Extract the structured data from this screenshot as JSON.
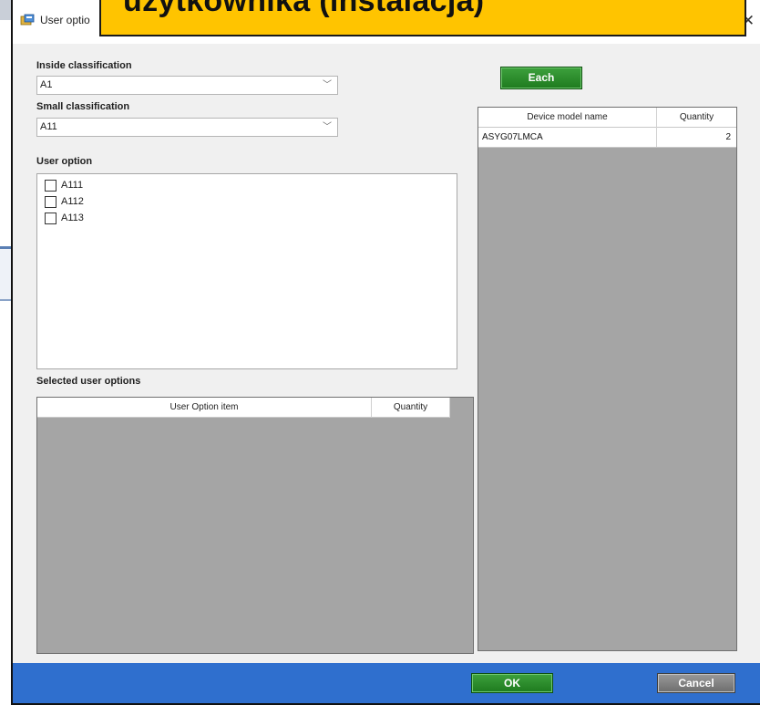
{
  "window": {
    "title": "User optio",
    "close_glyph": "✕",
    "banner_text": "użytkownika (instalacja)"
  },
  "inside_classification": {
    "label": "Inside classification",
    "value": "A1"
  },
  "small_classification": {
    "label": "Small classification",
    "value": "A11"
  },
  "user_option": {
    "label": "User option",
    "items": [
      {
        "label": "A111",
        "checked": false
      },
      {
        "label": "A112",
        "checked": false
      },
      {
        "label": "A113",
        "checked": false
      }
    ]
  },
  "selected_user_options": {
    "label": "Selected user options",
    "columns": [
      "User Option item",
      "Quantity"
    ],
    "rows": []
  },
  "device_grid": {
    "each_button": "Each",
    "columns": [
      "Device model name",
      "Quantity"
    ],
    "rows": [
      {
        "model": "ASYG07LMCA",
        "quantity": "2"
      }
    ]
  },
  "footer": {
    "ok_label": "OK",
    "cancel_label": "Cancel"
  },
  "colors": {
    "banner": "#ffc400",
    "footer": "#2f6fce",
    "primary_button": "#2a8a2a",
    "cancel_button": "#808080"
  },
  "icons": {
    "title": "app-window-icon",
    "close": "close-icon",
    "dropdown": "chevron-down-icon",
    "checkbox": "checkbox-icon"
  }
}
